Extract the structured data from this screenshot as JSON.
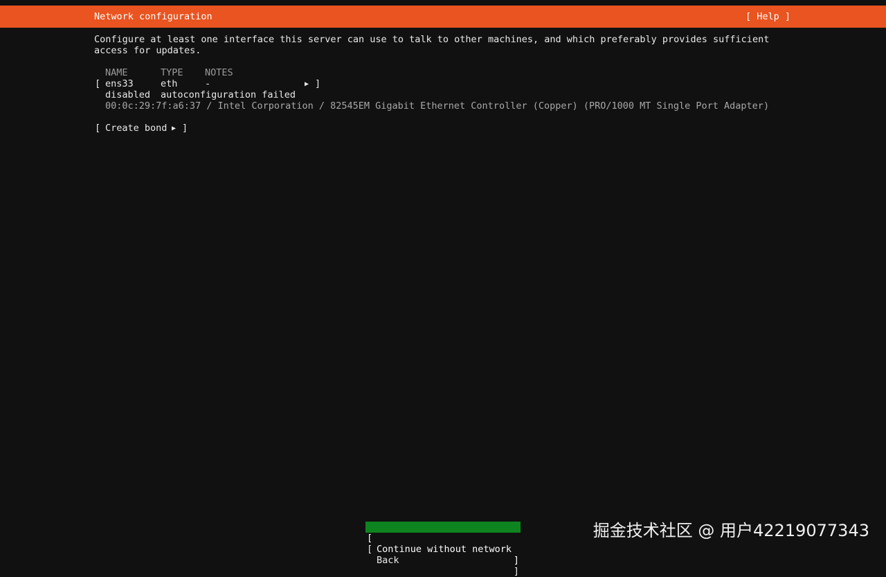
{
  "header": {
    "title": "Network configuration",
    "help_label": "[ Help ]"
  },
  "description": {
    "line1": "Configure at least one interface this server can use to talk to other machines, and which preferably provides sufficient",
    "line2": "access for updates."
  },
  "table": {
    "columns": [
      "NAME",
      "TYPE",
      "NOTES"
    ],
    "interfaces": [
      {
        "name": "ens33",
        "type": "eth",
        "notes": "-",
        "status": "disabled",
        "status_detail": "autoconfiguration failed",
        "hardware": "00:0c:29:7f:a6:37 / Intel Corporation / 82545EM Gigabit Ethernet Controller (Copper) (PRO/1000 MT Single Port Adapter)"
      }
    ]
  },
  "create_bond_label": "Create bond",
  "buttons": {
    "continue_label": "Continue without network",
    "back_label": "Back"
  },
  "watermark": "掘金技术社区 @ 用户42219077343",
  "colors": {
    "accent": "#e95420",
    "focus": "#0e8420",
    "background": "#111111"
  }
}
